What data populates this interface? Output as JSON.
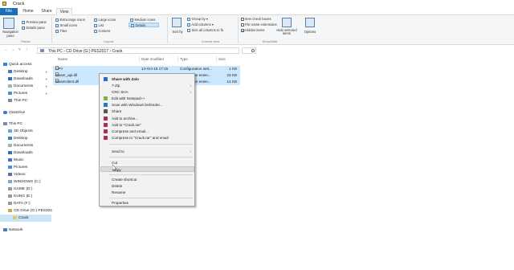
{
  "window": {
    "title": "Crack"
  },
  "tabs": [
    {
      "label": "File"
    },
    {
      "label": "Home"
    },
    {
      "label": "Share"
    },
    {
      "label": "View"
    }
  ],
  "ribbon": {
    "panes": {
      "navigation_pane": "Navigation pane",
      "preview_pane": "Preview pane",
      "details_pane": "Details pane",
      "group_label": "Panes"
    },
    "layout": {
      "items": [
        "Extra large icons",
        "Large icons",
        "Medium icons",
        "Small icons",
        "List",
        "Details",
        "Tiles",
        "Content"
      ],
      "group_label": "Layout"
    },
    "current_view": {
      "sort_by": "Sort by",
      "group_by": "Group by",
      "add_columns": "Add columns",
      "size_all_columns": "Size all columns to fit",
      "group_label": "Current view"
    },
    "show_hide": {
      "item_check_boxes": "Item check boxes",
      "file_name_extensions": "File name extensions",
      "hidden_items": "Hidden items",
      "hide_selected": "Hide selected items",
      "group_label": "Show/hide"
    },
    "options": "Options"
  },
  "address": {
    "crumb": "This PC  ›  CD Drive (G:) PES2017  ›  Crack",
    "search_placeholder": ""
  },
  "navpane": {
    "items": [
      {
        "label": "Quick access",
        "indent": 0
      },
      {
        "label": "Desktop",
        "indent": 1,
        "pinned": true
      },
      {
        "label": "Downloads",
        "indent": 1,
        "pinned": true
      },
      {
        "label": "Documents",
        "indent": 1,
        "pinned": true
      },
      {
        "label": "Pictures",
        "indent": 1,
        "pinned": true
      },
      {
        "label": "This PC",
        "indent": 1
      },
      {
        "label": "OneDrive",
        "indent": 0
      },
      {
        "label": "This PC",
        "indent": 0
      },
      {
        "label": "3D Objects",
        "indent": 1
      },
      {
        "label": "Desktop",
        "indent": 1
      },
      {
        "label": "Documents",
        "indent": 1
      },
      {
        "label": "Downloads",
        "indent": 1
      },
      {
        "label": "Music",
        "indent": 1
      },
      {
        "label": "Pictures",
        "indent": 1
      },
      {
        "label": "Videos",
        "indent": 1
      },
      {
        "label": "WINDOWS (C:)",
        "indent": 1
      },
      {
        "label": "GAME (D:)",
        "indent": 1
      },
      {
        "label": "DUNG (E:)",
        "indent": 1
      },
      {
        "label": "DATA (F:)",
        "indent": 1
      },
      {
        "label": "CD Drive (G:) PES2017",
        "indent": 1
      },
      {
        "label": "Crack",
        "indent": 2,
        "selected": true
      },
      {
        "label": "Network",
        "indent": 0
      }
    ]
  },
  "filelist": {
    "columns": {
      "name": "Name",
      "date": "Date modified",
      "type": "Type",
      "size": "Size"
    },
    "rows": [
      {
        "name": "CPY",
        "date": "14-Oct-16 17:15",
        "type": "Configuration sett...",
        "size": "1 KB"
      },
      {
        "name": "steam_api.dll",
        "date": "",
        "type": "Application exten...",
        "size": "23 KB"
      },
      {
        "name": "steamclient.dll",
        "date": "",
        "type": "Application exten...",
        "size": "14 KB"
      }
    ]
  },
  "context_menu": {
    "items": [
      {
        "label": "Share with Zalo",
        "bold": true,
        "icon": "zalo-icon",
        "color": "#1f6fd1"
      },
      {
        "label": "7-Zip",
        "submenu": true
      },
      {
        "label": "CRC SHA",
        "submenu": true
      },
      {
        "label": "Edit with Notepad++",
        "icon": "notepad-icon",
        "color": "#7cb342"
      },
      {
        "label": "Scan with Windows Defender...",
        "icon": "defender-icon",
        "color": "#3b6fc4"
      },
      {
        "label": "Share",
        "icon": "share-icon",
        "color": "#555555"
      },
      {
        "label": "Add to archive...",
        "icon": "winrar-icon",
        "color": "#a0345a"
      },
      {
        "label": "Add to \"Crack.rar\"",
        "icon": "winrar-icon",
        "color": "#a0345a"
      },
      {
        "label": "Compress and email...",
        "icon": "winrar-icon",
        "color": "#a0345a"
      },
      {
        "label": "Compress to \"Crack.rar\" and email",
        "icon": "winrar-icon",
        "color": "#a0345a"
      },
      {
        "sep": true
      },
      {
        "label": "Send to",
        "submenu": true
      },
      {
        "sep": true
      },
      {
        "label": "Cut"
      },
      {
        "label": "Copy",
        "hover": true
      },
      {
        "sep": true
      },
      {
        "label": "Create shortcut"
      },
      {
        "label": "Delete"
      },
      {
        "label": "Rename"
      },
      {
        "sep": true
      },
      {
        "label": "Properties"
      }
    ]
  }
}
